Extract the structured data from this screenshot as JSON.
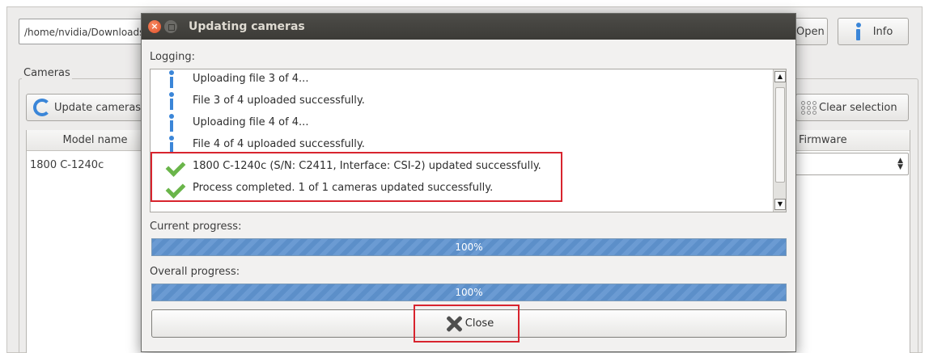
{
  "background_window": {
    "path_value": "/home/nvidia/Downloads",
    "open_label": "Open",
    "info_label": "Info",
    "cameras_group_title": "Cameras",
    "update_button_label": "Update cameras",
    "clear_selection_label": "Clear selection",
    "table": {
      "columns": [
        "Model name",
        "Firmware"
      ],
      "rows": [
        {
          "model": "1800 C-1240c"
        }
      ]
    }
  },
  "dialog": {
    "title": "Updating cameras",
    "close_glyph": "×",
    "logging_label": "Logging:",
    "log_entries": [
      {
        "icon": "info-icon",
        "text": "Uploading file 3 of 4..."
      },
      {
        "icon": "info-icon",
        "text": "File 3 of 4 uploaded successfully."
      },
      {
        "icon": "info-icon",
        "text": "Uploading file 4 of 4..."
      },
      {
        "icon": "info-icon",
        "text": "File 4 of 4 uploaded successfully."
      },
      {
        "icon": "check-icon",
        "text": "1800 C-1240c (S/N: C2411, Interface: CSI-2) updated successfully."
      },
      {
        "icon": "check-icon",
        "text": "Process completed. 1 of 1 cameras updated successfully."
      }
    ],
    "current_progress_label": "Current progress:",
    "current_progress": {
      "value": 1.0,
      "text": "100%"
    },
    "overall_progress_label": "Overall progress:",
    "overall_progress": {
      "value": 1.0,
      "text": "100%"
    },
    "close_button_label": "Close"
  },
  "colors": {
    "titlebar": "#3c3b37",
    "progress_fill": "#5c8fc9",
    "highlight": "#d8242e",
    "success_check": "#6ab54a",
    "info_blue": "#3b86d8"
  }
}
